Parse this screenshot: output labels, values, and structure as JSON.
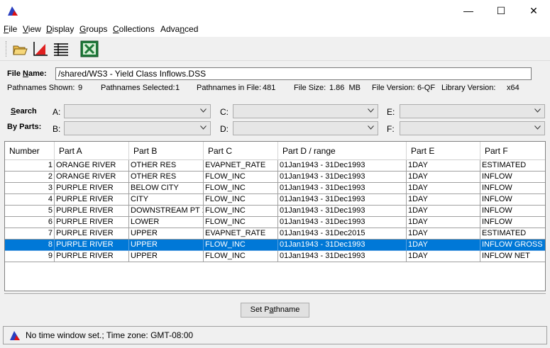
{
  "window": {
    "minimize_glyph": "—",
    "maximize_glyph": "☐",
    "close_glyph": "✕"
  },
  "menu": {
    "items": [
      {
        "pre": "",
        "u": "F",
        "post": "ile"
      },
      {
        "pre": "",
        "u": "V",
        "post": "iew"
      },
      {
        "pre": "",
        "u": "D",
        "post": "isplay"
      },
      {
        "pre": "",
        "u": "G",
        "post": "roups"
      },
      {
        "pre": "",
        "u": "C",
        "post": "ollections"
      },
      {
        "pre": "Adva",
        "u": "n",
        "post": "ced"
      }
    ]
  },
  "toolbar": {
    "icons": [
      "open-folder-icon",
      "plot-icon",
      "tabulate-icon",
      "excel-icon"
    ]
  },
  "file": {
    "label_pre": "File ",
    "label_u": "N",
    "label_post": "ame:",
    "value": "/shared/WS3 - Yield Class Inflows.DSS"
  },
  "info": {
    "pathnames_shown_label": "Pathnames Shown:",
    "pathnames_shown": "9",
    "pathnames_selected_label": "Pathnames Selected:",
    "pathnames_selected": "1",
    "pathnames_in_file_label": "Pathnames in File:",
    "pathnames_in_file": "481",
    "file_size_label": "File Size:",
    "file_size": "1.86  MB",
    "file_version_label": "File Version:",
    "file_version": "6-QF",
    "library_version_label": "Library Version:",
    "library_version": "x64"
  },
  "search": {
    "search_label_u": "S",
    "search_label_post": "earch",
    "byparts_label": "By Parts:",
    "parts": [
      {
        "label": "A:",
        "value": ""
      },
      {
        "label": "B:",
        "value": ""
      },
      {
        "label": "C:",
        "value": ""
      },
      {
        "label": "D:",
        "value": ""
      },
      {
        "label": "E:",
        "value": ""
      },
      {
        "label": "F:",
        "value": ""
      }
    ]
  },
  "table": {
    "columns": [
      "Number",
      "Part A",
      "Part B",
      "Part C",
      "Part D / range",
      "Part E",
      "Part F"
    ],
    "rows": [
      [
        "1",
        "ORANGE RIVER",
        "OTHER RES",
        "EVAPNET_RATE",
        "01Jan1943 - 31Dec1993",
        "1DAY",
        "ESTIMATED"
      ],
      [
        "2",
        "ORANGE RIVER",
        "OTHER RES",
        "FLOW_INC",
        "01Jan1943 - 31Dec1993",
        "1DAY",
        "INFLOW"
      ],
      [
        "3",
        "PURPLE RIVER",
        "BELOW CITY",
        "FLOW_INC",
        "01Jan1943 - 31Dec1993",
        "1DAY",
        "INFLOW"
      ],
      [
        "4",
        "PURPLE RIVER",
        "CITY",
        "FLOW_INC",
        "01Jan1943 - 31Dec1993",
        "1DAY",
        "INFLOW"
      ],
      [
        "5",
        "PURPLE RIVER",
        "DOWNSTREAM PT 1",
        "FLOW_INC",
        "01Jan1943 - 31Dec1993",
        "1DAY",
        "INFLOW"
      ],
      [
        "6",
        "PURPLE RIVER",
        "LOWER",
        "FLOW_INC",
        "01Jan1943 - 31Dec1993",
        "1DAY",
        "INFLOW"
      ],
      [
        "7",
        "PURPLE RIVER",
        "UPPER",
        "EVAPNET_RATE",
        "01Jan1943 - 31Dec2015",
        "1DAY",
        "ESTIMATED"
      ],
      [
        "8",
        "PURPLE RIVER",
        "UPPER",
        "FLOW_INC",
        "01Jan1943 - 31Dec1993",
        "1DAY",
        "INFLOW GROSS"
      ],
      [
        "9",
        "PURPLE RIVER",
        "UPPER",
        "FLOW_INC",
        "01Jan1943 - 31Dec1993",
        "1DAY",
        "INFLOW NET"
      ]
    ],
    "selected_row": 8,
    "selection_color": "#0078d7"
  },
  "set_button": {
    "pre": "Set P",
    "u": "a",
    "post": "thname"
  },
  "status": {
    "text": "No time window set.;  Time zone: GMT-08:00"
  }
}
